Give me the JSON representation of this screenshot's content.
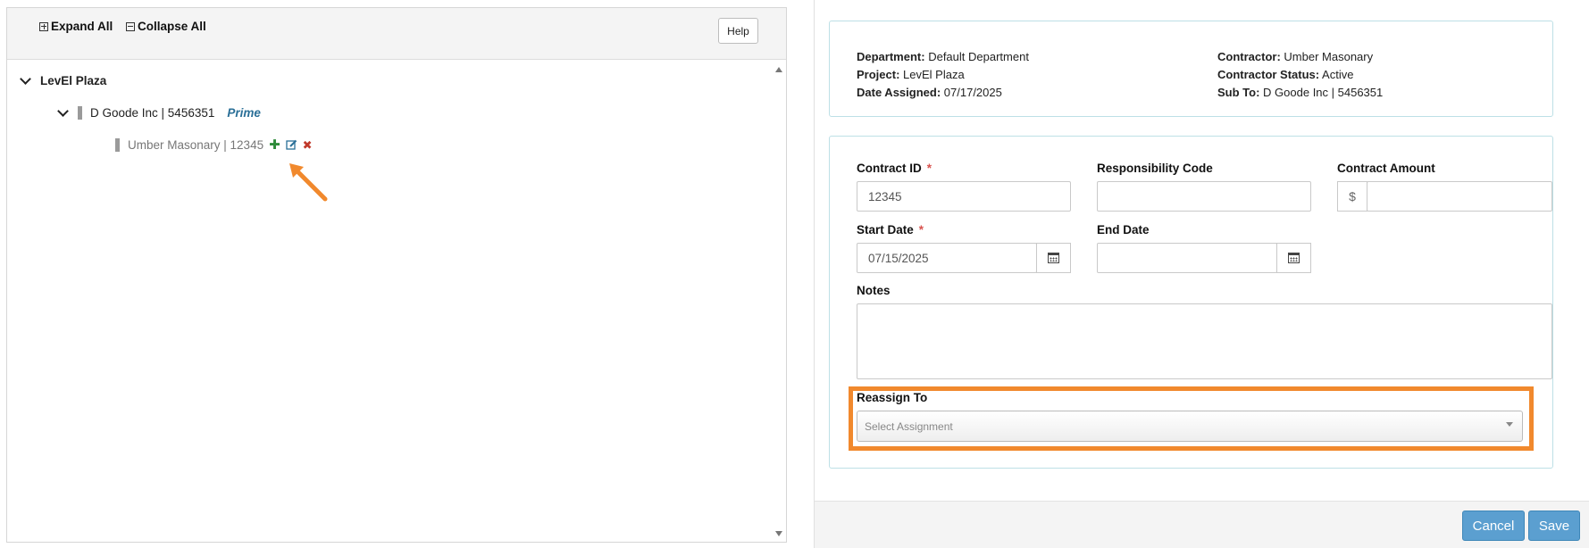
{
  "tree": {
    "toolbar": {
      "expand_all": "Expand All",
      "collapse_all": "Collapse All",
      "help": "Help"
    },
    "root": {
      "label": "LevEl Plaza"
    },
    "prime": {
      "label": "D Goode Inc | 5456351",
      "tag": "Prime"
    },
    "sub": {
      "label": "Umber Masonary | 12345"
    }
  },
  "info": {
    "department": {
      "label": "Department:",
      "value": "Default Department"
    },
    "project": {
      "label": "Project:",
      "value": "LevEl Plaza"
    },
    "date_assigned": {
      "label": "Date Assigned:",
      "value": "07/17/2025"
    },
    "contractor": {
      "label": "Contractor:",
      "value": "Umber Masonary"
    },
    "contractor_status": {
      "label": "Contractor Status:",
      "value": "Active"
    },
    "sub_to": {
      "label": "Sub To:",
      "value": "D Goode Inc | 5456351"
    }
  },
  "form": {
    "contract_id": {
      "label": "Contract ID",
      "required": "*",
      "value": "12345"
    },
    "responsibility_code": {
      "label": "Responsibility Code",
      "value": ""
    },
    "contract_amount": {
      "label": "Contract Amount",
      "prefix": "$",
      "value": ""
    },
    "start_date": {
      "label": "Start Date",
      "required": "*",
      "value": "07/15/2025"
    },
    "end_date": {
      "label": "End Date",
      "value": ""
    },
    "notes": {
      "label": "Notes",
      "value": ""
    },
    "reassign_to": {
      "label": "Reassign To",
      "placeholder": "Select Assignment"
    }
  },
  "footer": {
    "cancel": "Cancel",
    "save": "Save"
  },
  "colors": {
    "highlight": "#f1892d",
    "primary_button": "#5b9fd0",
    "prime_tag": "#2a6f97",
    "required": "#d9534f"
  },
  "icons": {
    "expand": "plus-square-icon",
    "collapse": "minus-square-icon",
    "add": "plus-icon",
    "edit": "edit-icon",
    "delete": "x-icon",
    "calendar": "calendar-icon",
    "caret": "chevron-down-icon"
  }
}
